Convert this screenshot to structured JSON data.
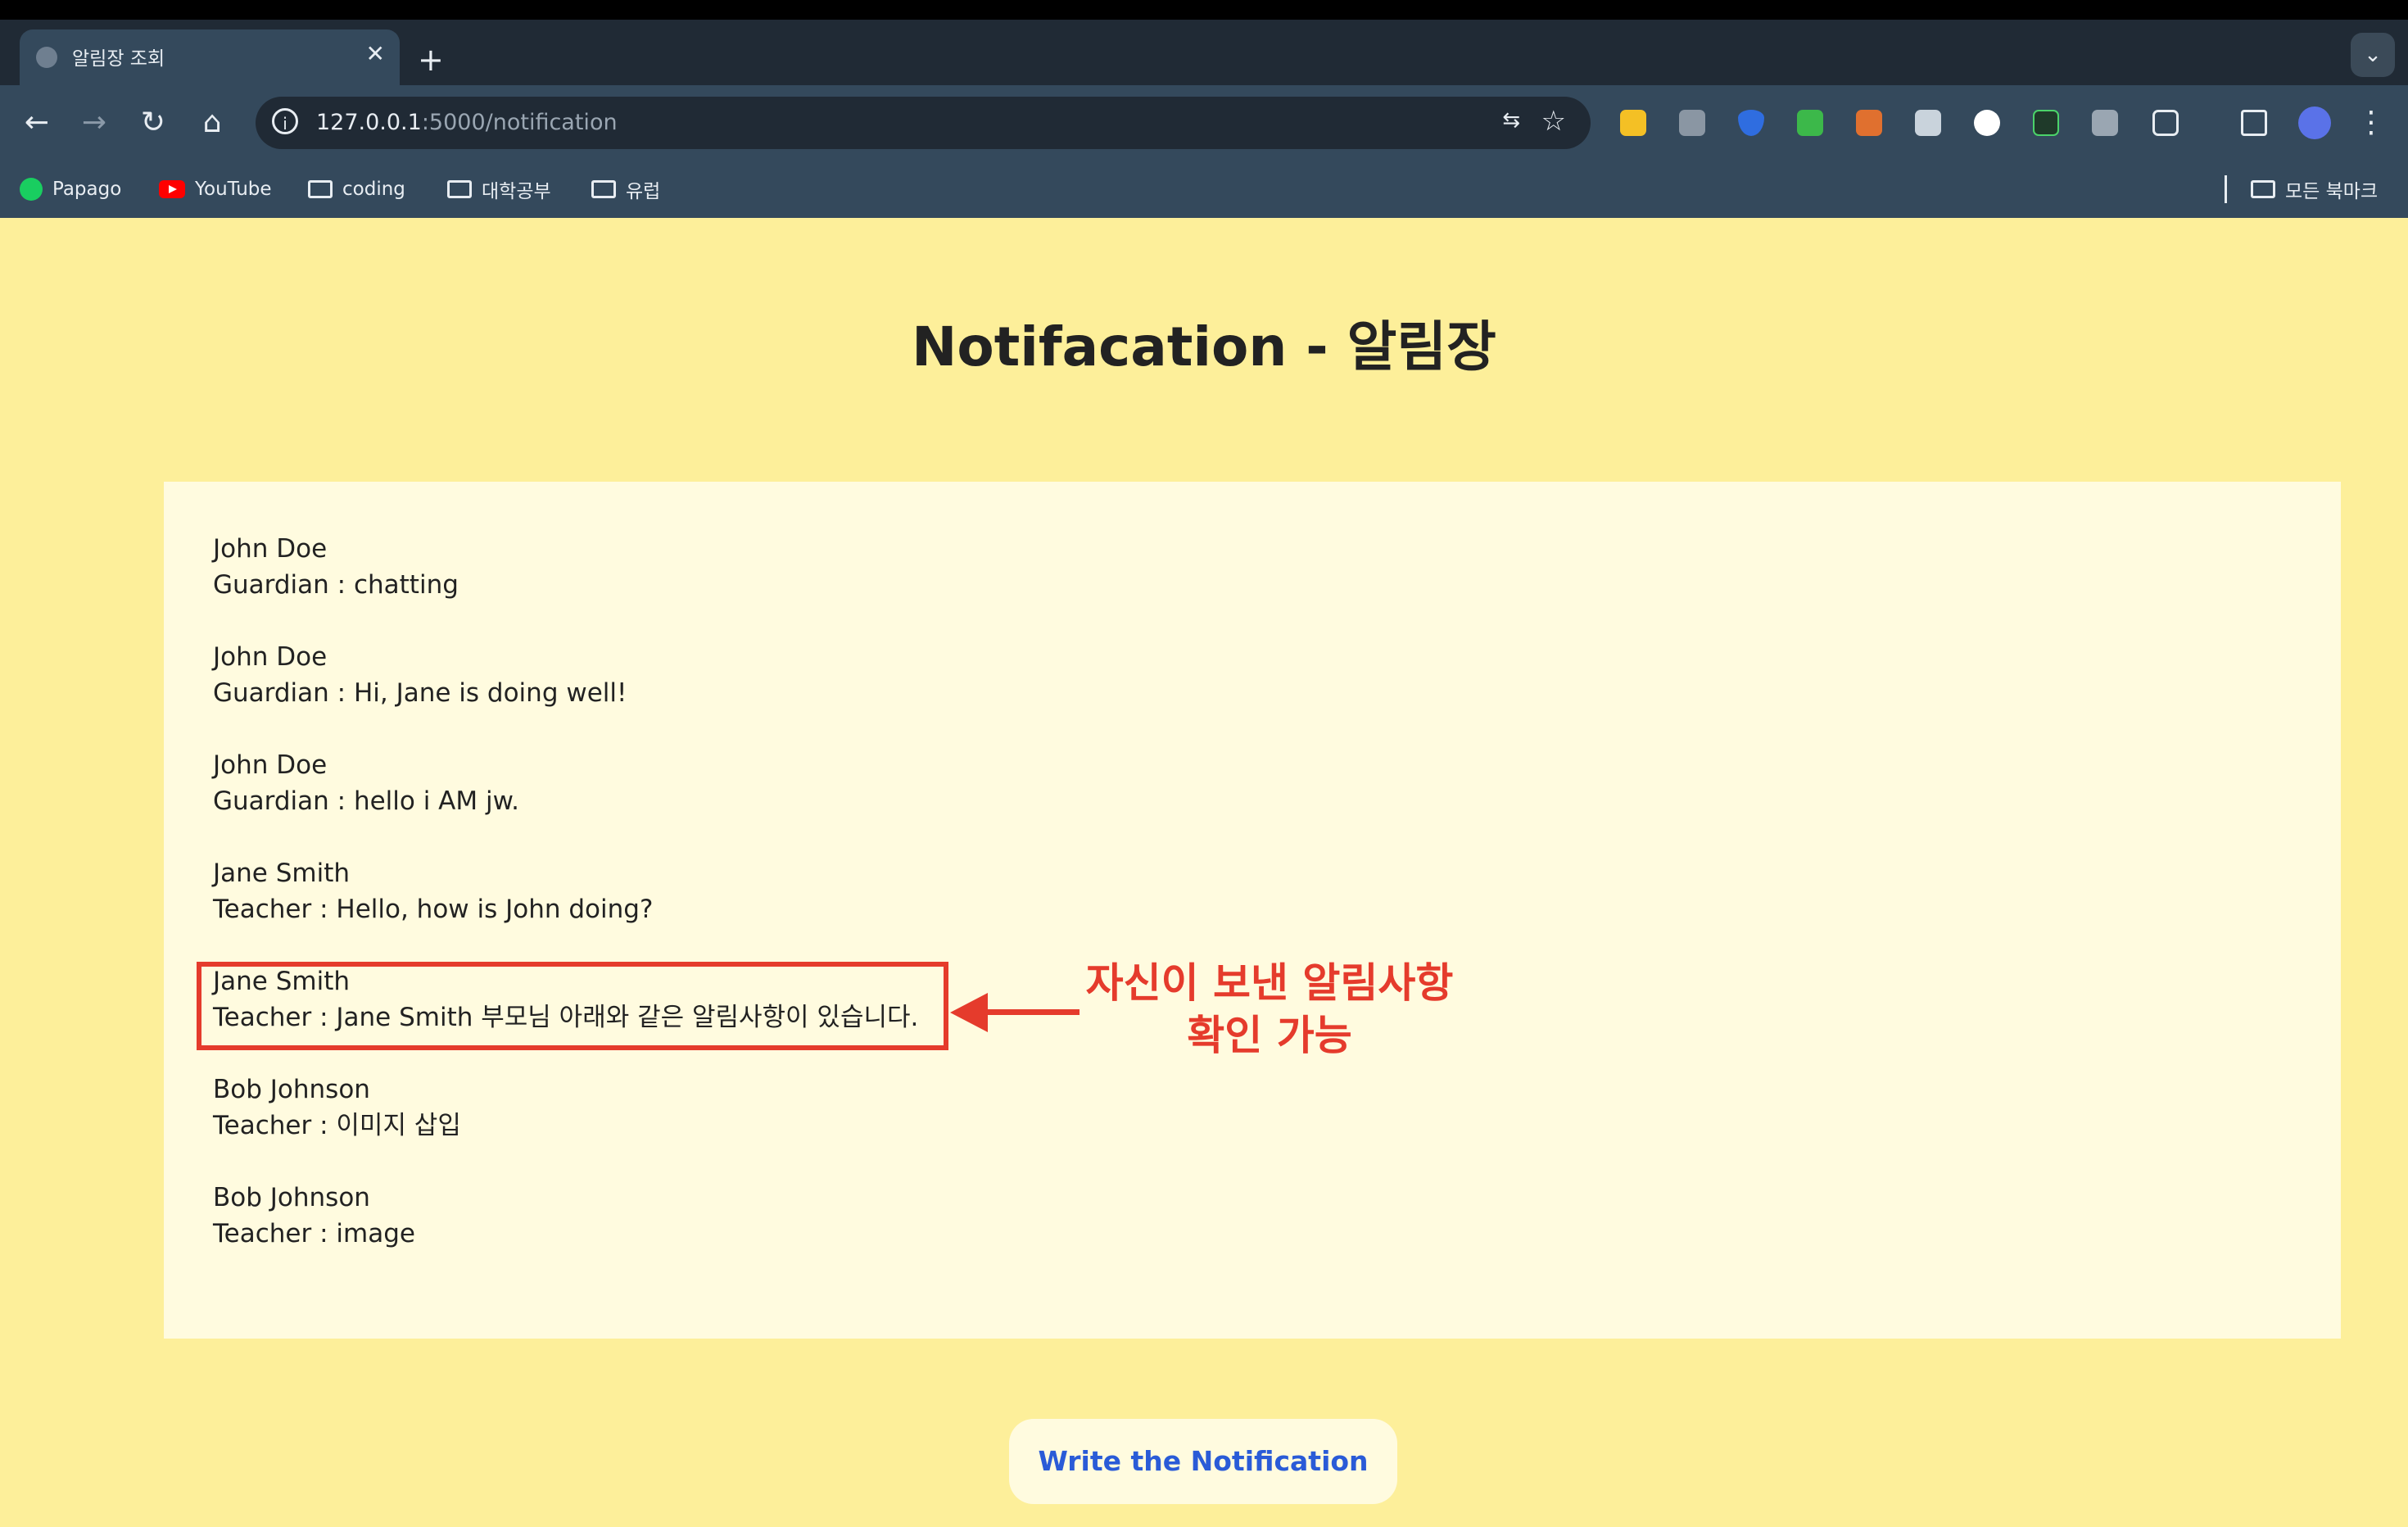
{
  "browser": {
    "tab_title": "알림장 조회",
    "tab_close": "✕",
    "new_tab": "+",
    "tab_menu": "⌄",
    "url_host": "127.0.0.1",
    "url_rest": ":5000/notification",
    "bookmarks": [
      "Papago",
      "YouTube",
      "coding",
      "대학공부",
      "유럽"
    ],
    "all_bookmarks": "모든 북마크"
  },
  "page": {
    "title": "Notifacation - 알림장",
    "notifications": [
      {
        "sender": "John Doe",
        "message": "Guardian : chatting"
      },
      {
        "sender": "John Doe",
        "message": "Guardian : Hi, Jane is doing well!"
      },
      {
        "sender": "John Doe",
        "message": "Guardian : hello i AM jw."
      },
      {
        "sender": "Jane Smith",
        "message": "Teacher : Hello, how is John doing?"
      },
      {
        "sender": "Jane Smith",
        "message": "Teacher : Jane Smith 부모님 아래와 같은 알림사항이 있습니다."
      },
      {
        "sender": "Bob Johnson",
        "message": "Teacher : 이미지 삽입"
      },
      {
        "sender": "Bob Johnson",
        "message": "Teacher : image"
      }
    ],
    "annotation_line1": "자신이 보낸 알림사항",
    "annotation_line2": "확인 가능",
    "write_button": "Write the Notification"
  },
  "colors": {
    "page_bg": "#fdef9a",
    "card_bg": "#fffbdf",
    "annotation": "#e53b2c",
    "button_text": "#2a5bd7"
  }
}
